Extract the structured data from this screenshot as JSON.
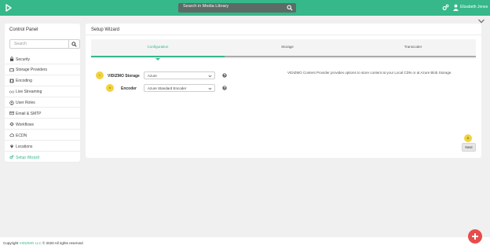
{
  "colors": {
    "brand": "#36b88a",
    "search_bg": "#5b6b66",
    "hint": "#f2d23d",
    "fab": "#e74c4c"
  },
  "topbar": {
    "search_placeholder": "Search in Media Library",
    "user_name": "Elizabeth Jones"
  },
  "sidebar": {
    "title": "Control Panel",
    "search_placeholder": "Search",
    "items": [
      {
        "label": "Security",
        "icon": "lock-icon"
      },
      {
        "label": "Storage Providers",
        "icon": "hard-drive-icon"
      },
      {
        "label": "Encoding",
        "icon": "film-icon"
      },
      {
        "label": "Live Streaming",
        "icon": "broadcast-icon"
      },
      {
        "label": "User Roles",
        "icon": "user-circle-icon"
      },
      {
        "label": "Email & SMTP",
        "icon": "envelope-icon"
      },
      {
        "label": "Workflows",
        "icon": "workflow-icon"
      },
      {
        "label": "ECDN",
        "icon": "cloud-icon"
      },
      {
        "label": "Locations",
        "icon": "map-pin-icon"
      },
      {
        "label": "Setup Wizard",
        "icon": "gears-icon"
      }
    ]
  },
  "main": {
    "title": "Setup Wizard",
    "steps": [
      {
        "label": "Configuration",
        "active": true
      },
      {
        "label": "Storage",
        "active": false
      },
      {
        "label": "Transcoder",
        "active": false
      }
    ],
    "fields": [
      {
        "hint": "i",
        "label": "VIDIZMO Storage",
        "value": "Azure"
      },
      {
        "hint": "ii",
        "label": "Encoder",
        "value": "Azure Standard Encoder"
      }
    ],
    "description": "VIDIZMO Content Provider provides options to store content at your Local CDN or at Azure Blob Storage.",
    "next_hint": "iii",
    "next_label": "Next"
  },
  "footer": {
    "copyright_prefix": "Copyright ",
    "company_link": "VIDIZMO LLC",
    "copyright_suffix": " © 2020 All rights reserved"
  }
}
